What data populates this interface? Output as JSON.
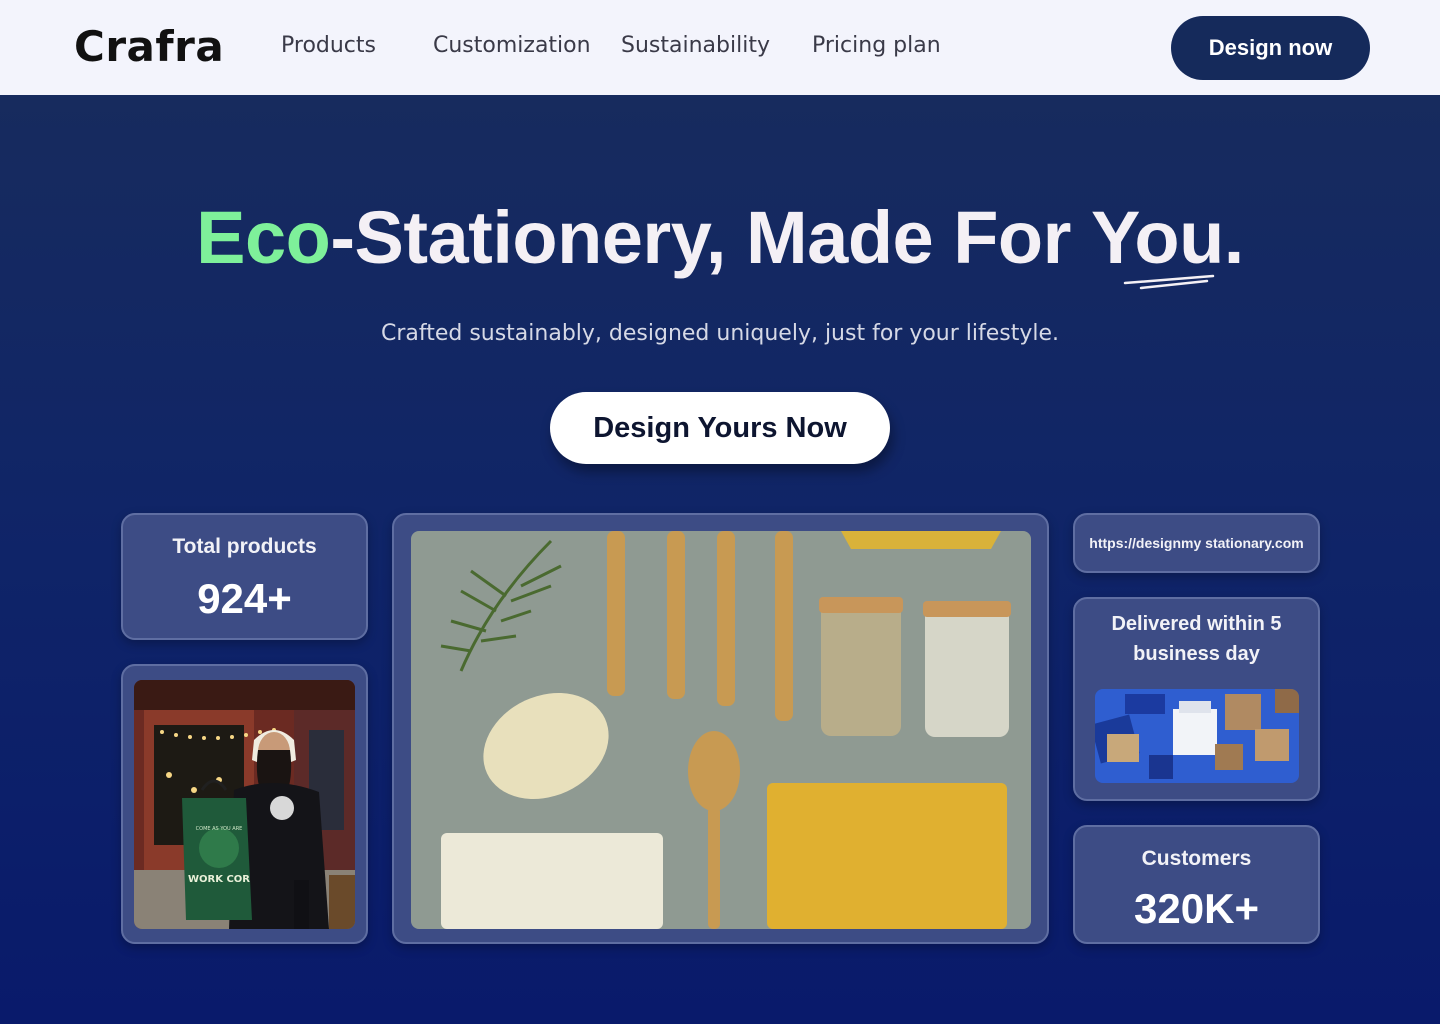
{
  "navbar": {
    "logo": "Crafra",
    "links": [
      "Products",
      "Customization",
      "Sustainability",
      "Pricing plan"
    ],
    "cta_label": "Design now"
  },
  "hero": {
    "headline_accent": "Eco",
    "headline_main": "-Stationery, Made For ",
    "headline_end": "You",
    "headline_period": ".",
    "subtitle": "Crafted sustainably, designed uniquely, just for your lifestyle.",
    "cta_label": "Design Yours Now"
  },
  "cards": {
    "total_products": {
      "label": "Total products",
      "value": "924+"
    },
    "website": {
      "url": "https://designmy stationary.com"
    },
    "delivery": {
      "label_line1": "Delivered within 5",
      "label_line2": "business day"
    },
    "customers": {
      "label": "Customers",
      "value": "320K+"
    }
  },
  "tote": {
    "text_top": "COME AS YOU ARE",
    "text_main": "WORK COR"
  },
  "colors": {
    "nav_bg": "#f3f4fc",
    "nav_button": "#152a5b",
    "hero_top": "#172b5e",
    "hero_bottom": "#091a6b",
    "accent_green": "#7ef09a",
    "card_bg": "#3d4c85"
  }
}
